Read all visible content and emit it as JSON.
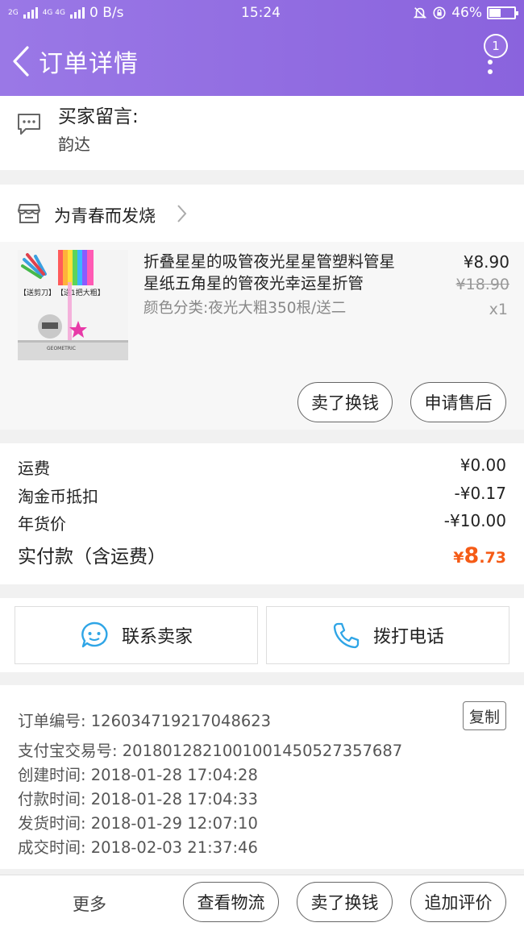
{
  "status_bar": {
    "network_left": "2G",
    "network_right": "4G 4G",
    "speed": "0 B/s",
    "time": "15:24",
    "battery": "46%",
    "battery_level": 0.46
  },
  "header": {
    "title": "订单详情",
    "badge_count": "1"
  },
  "buyer_message": {
    "label": "买家留言:",
    "value": "韵达"
  },
  "shop": {
    "name": "为青春而发烧"
  },
  "product": {
    "title": "折叠星星的吸管夜光星星管塑料管星星纸五角星的管夜光幸运星折管",
    "sku": "颜色分类:夜光大粗350根/送二",
    "price": "¥8.90",
    "original_price": "¥18.90",
    "quantity": "x1",
    "thumb_labels": [
      "【送剪刀】",
      "【送1把大粗】"
    ],
    "ruler_text": "GEOMETRIC",
    "actions": [
      "卖了换钱",
      "申请售后"
    ]
  },
  "fees": [
    {
      "label": "运费",
      "value": "¥0.00"
    },
    {
      "label": "淘金币抵扣",
      "value": "-¥0.17"
    },
    {
      "label": "年货价",
      "value": "-¥10.00"
    }
  ],
  "total": {
    "label": "实付款（含运费）",
    "currency": "¥",
    "integer": "8",
    "decimal": ".73"
  },
  "contact": {
    "seller": "联系卖家",
    "phone": "拨打电话"
  },
  "order_info": {
    "order_no": "订单编号: 1260347192170486 23",
    "rows": [
      "订单编号: 126034719217048623",
      "支付宝交易号: 2018012821001001450527357687",
      "创建时间: 2018-01-28 17:04:28",
      "付款时间: 2018-01-28 17:04:33",
      "发货时间: 2018-01-29 12:07:10",
      "成交时间: 2018-02-03 21:37:46"
    ],
    "copy_label": "复制"
  },
  "bottom_bar": {
    "more": "更多",
    "buttons": [
      "查看物流",
      "卖了换钱",
      "追加评价"
    ]
  },
  "colors": {
    "header_bg": "#8a63dd",
    "accent_price": "#f55b16",
    "icon_blue": "#2fa5e6"
  }
}
